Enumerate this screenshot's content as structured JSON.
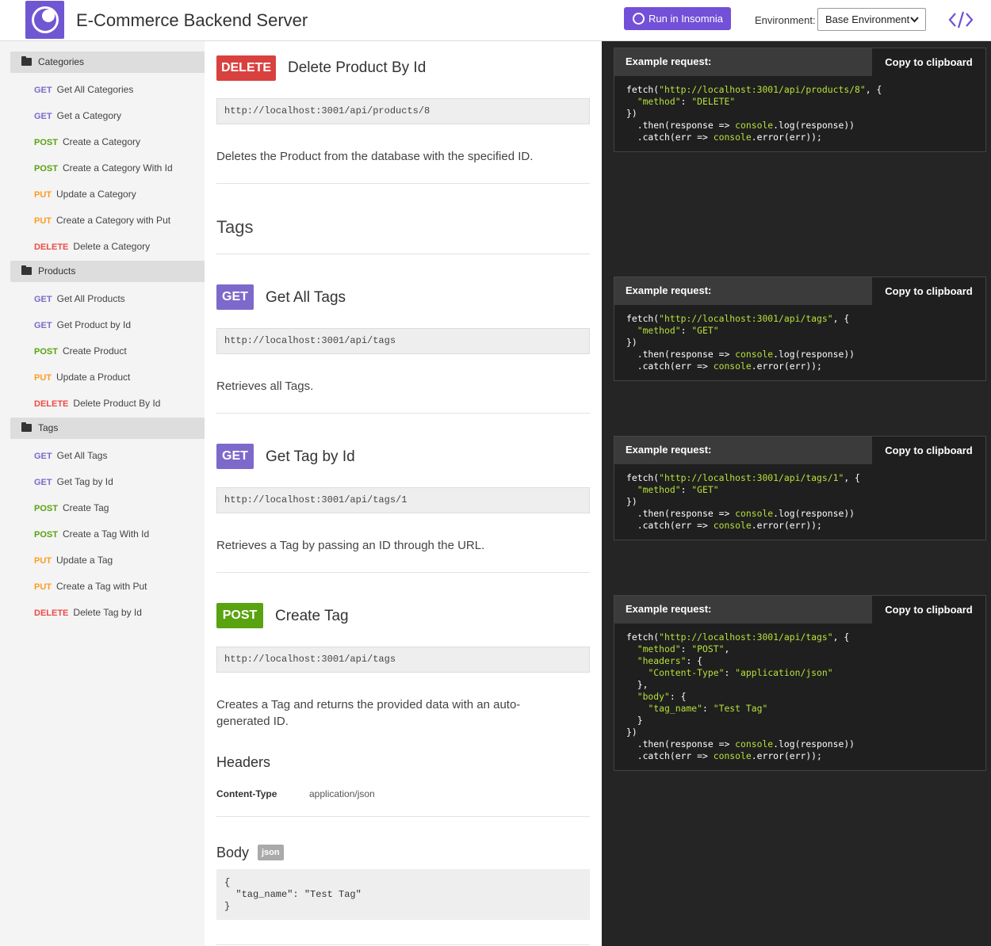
{
  "header": {
    "title": "E-Commerce Backend Server",
    "run_label": "Run in Insomnia",
    "env_label": "Environment:",
    "env_value": "Base Environment"
  },
  "sidebar": {
    "groups": [
      {
        "label": "Categories",
        "items": [
          {
            "method": "GET",
            "label": "Get All Categories"
          },
          {
            "method": "GET",
            "label": "Get a Category"
          },
          {
            "method": "POST",
            "label": "Create a Category"
          },
          {
            "method": "POST",
            "label": "Create a Category With Id"
          },
          {
            "method": "PUT",
            "label": "Update a Category"
          },
          {
            "method": "PUT",
            "label": "Create a Category with Put"
          },
          {
            "method": "DELETE",
            "label": "Delete a Category"
          }
        ]
      },
      {
        "label": "Products",
        "items": [
          {
            "method": "GET",
            "label": "Get All Products"
          },
          {
            "method": "GET",
            "label": "Get Product by Id"
          },
          {
            "method": "POST",
            "label": "Create Product"
          },
          {
            "method": "PUT",
            "label": "Update a Product"
          },
          {
            "method": "DELETE",
            "label": "Delete Product By Id"
          }
        ]
      },
      {
        "label": "Tags",
        "items": [
          {
            "method": "GET",
            "label": "Get All Tags"
          },
          {
            "method": "GET",
            "label": "Get Tag by Id"
          },
          {
            "method": "POST",
            "label": "Create Tag"
          },
          {
            "method": "POST",
            "label": "Create a Tag With Id"
          },
          {
            "method": "PUT",
            "label": "Update a Tag"
          },
          {
            "method": "PUT",
            "label": "Create a Tag with Put"
          },
          {
            "method": "DELETE",
            "label": "Delete Tag by Id"
          }
        ]
      }
    ]
  },
  "main": {
    "delete_product": {
      "method": "DELETE",
      "title": "Delete Product By Id",
      "url": "http://localhost:3001/api/products/8",
      "description": "Deletes the Product from the database with the specified ID."
    },
    "tags_section": "Tags",
    "get_all_tags": {
      "method": "GET",
      "title": "Get All Tags",
      "url": "http://localhost:3001/api/tags",
      "description": "Retrieves all Tags."
    },
    "get_tag_by_id": {
      "method": "GET",
      "title": "Get Tag by Id",
      "url": "http://localhost:3001/api/tags/1",
      "description": "Retrieves a Tag by passing an ID through the URL."
    },
    "create_tag": {
      "method": "POST",
      "title": "Create Tag",
      "url": "http://localhost:3001/api/tags",
      "description": "Creates a Tag and returns the provided data with an auto-generated ID.",
      "headers_title": "Headers",
      "header_key": "Content-Type",
      "header_value": "application/json",
      "body_title": "Body",
      "body_tag": "json",
      "body": "{\n  \"tag_name\": \"Test Tag\"\n}"
    }
  },
  "examples": {
    "label": "Example request:",
    "copy_label": "Copy to clipboard",
    "ex1": {
      "url": "\"http://localhost:3001/api/products/8\"",
      "method": "\"DELETE\""
    },
    "ex2": {
      "url": "\"http://localhost:3001/api/tags\"",
      "method": "\"GET\""
    },
    "ex3": {
      "url": "\"http://localhost:3001/api/tags/1\"",
      "method": "\"GET\""
    },
    "ex4": {
      "url": "\"http://localhost:3001/api/tags\"",
      "method": "\"POST\"",
      "content_type": "\"application/json\"",
      "tag_name": "\"Test Tag\""
    }
  }
}
